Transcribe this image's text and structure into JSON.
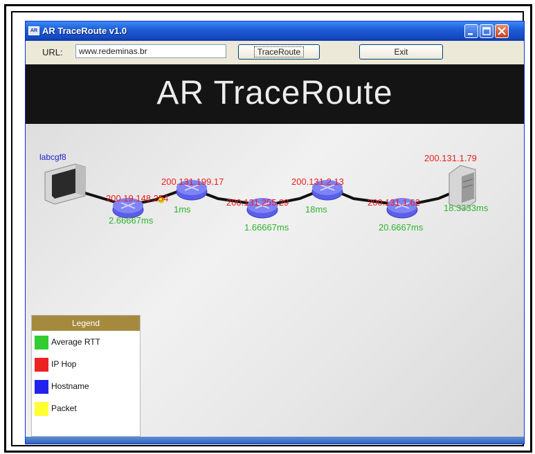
{
  "window": {
    "title": "AR TraceRoute v1.0",
    "icon_text": "AR"
  },
  "toolbar": {
    "url_label": "URL:",
    "url_value": "www.redeminas.br",
    "trace_label": "TraceRoute",
    "exit_label": "Exit"
  },
  "banner": {
    "text": "AR  TraceRoute"
  },
  "scene": {
    "source_host": "labcgf8",
    "hops": [
      {
        "ip": "200.19.148.254",
        "rtt": "2.66667ms"
      },
      {
        "ip": "200.131.199.17",
        "rtt": "1ms"
      },
      {
        "ip": "200.131.255.29",
        "rtt": "1.66667ms"
      },
      {
        "ip": "200.131.2.13",
        "rtt": "18ms"
      },
      {
        "ip": "200.131.1.62",
        "rtt": "20.6667ms"
      }
    ],
    "destination": {
      "ip": "200.131.1.79",
      "rtt": "18.3333ms"
    }
  },
  "legend": {
    "title": "Legend",
    "items": [
      {
        "label": "Average  RTT",
        "color": "#33cc33"
      },
      {
        "label": "IP  Hop",
        "color": "#ee2222"
      },
      {
        "label": "Hostname",
        "color": "#2222ee"
      },
      {
        "label": "Packet",
        "color": "#ffff33"
      }
    ]
  },
  "colors": {
    "ip": "#ee1c1c",
    "rtt": "#2fb42f",
    "hostname": "#2020c8",
    "router": "#6b6ef0",
    "packet": "#f5e62a"
  }
}
